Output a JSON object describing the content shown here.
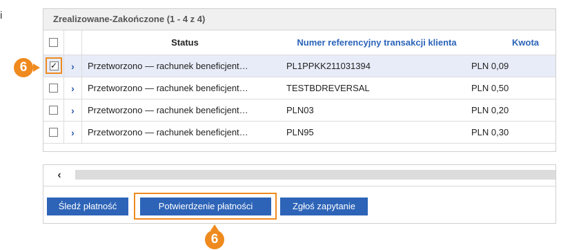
{
  "stray_char": "i",
  "table": {
    "title": "Zrealizowane-Zakończone (1 - 4 z 4)",
    "columns": {
      "status": "Status",
      "reference": "Numer referencyjny transakcji klienta",
      "amount": "Kwota"
    },
    "rows": [
      {
        "checked": true,
        "check_glyph": "✓",
        "status": "Przetworzono — rachunek beneficjent…",
        "reference": "PL1PPKK211031394",
        "amount": "PLN 0,09"
      },
      {
        "checked": false,
        "check_glyph": "",
        "status": "Przetworzono — rachunek beneficjent…",
        "reference": "TESTBDREVERSAL",
        "amount": "PLN 0,50"
      },
      {
        "checked": false,
        "check_glyph": "",
        "status": "Przetworzono — rachunek beneficjent…",
        "reference": "PLN03",
        "amount": "PLN 0,20"
      },
      {
        "checked": false,
        "check_glyph": "",
        "status": "Przetworzono — rachunek beneficjent…",
        "reference": "PLN95",
        "amount": "PLN 0,30"
      }
    ]
  },
  "icons": {
    "expand": "›",
    "scroll_left": "‹"
  },
  "actions": {
    "track_label": "Śledź płatność",
    "confirm_label": "Potwierdzenie płatności",
    "inquiry_label": "Zgłoś zapytanie"
  },
  "callouts": {
    "row_step": "6",
    "button_step": "6"
  },
  "colors": {
    "accent": "#ef8a1e",
    "button": "#2d64b8",
    "header_link": "#2a63b8",
    "selected_row": "#e7ecf8"
  }
}
